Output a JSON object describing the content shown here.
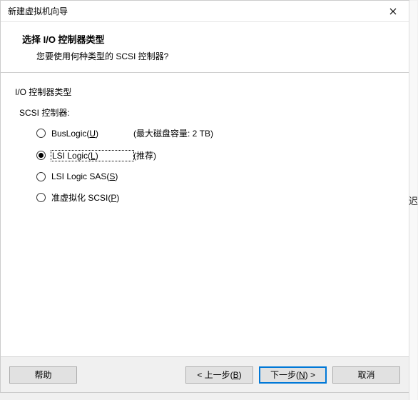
{
  "titlebar": {
    "title": "新建虚拟机向导"
  },
  "header": {
    "title": "选择 I/O 控制器类型",
    "subtitle": "您要使用何种类型的 SCSI 控制器?"
  },
  "content": {
    "section_label": "I/O 控制器类型",
    "subsection_label": "SCSI 控制器:",
    "options": [
      {
        "label_pre": "BusLogic(",
        "accel": "U",
        "label_post": ")",
        "hint": "(最大磁盘容量: 2 TB)",
        "checked": false,
        "focused": false
      },
      {
        "label_pre": "LSI Logic(",
        "accel": "L",
        "label_post": ")",
        "hint": "(推荐)",
        "checked": true,
        "focused": true
      },
      {
        "label_pre": "LSI Logic SAS(",
        "accel": "S",
        "label_post": ")",
        "hint": "",
        "checked": false,
        "focused": false
      },
      {
        "label_pre": "准虚拟化 SCSI(",
        "accel": "P",
        "label_post": ")",
        "hint": "",
        "checked": false,
        "focused": false
      }
    ]
  },
  "footer": {
    "help": "帮助",
    "back_pre": "< 上一步(",
    "back_accel": "B",
    "back_post": ")",
    "next_pre": "下一步(",
    "next_accel": "N",
    "next_post": ") >",
    "cancel": "取消"
  },
  "side_glyph": "迟"
}
